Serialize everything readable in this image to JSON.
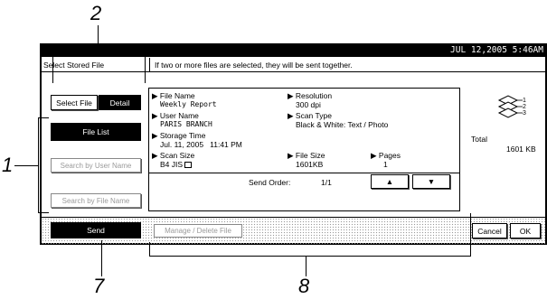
{
  "callouts": {
    "top": "2",
    "left": "1",
    "bottom_left": "7",
    "bottom_mid": "8"
  },
  "status": {
    "datetime": "JUL  12,2005  5:46AM"
  },
  "header": {
    "title": "Select Stored File",
    "notice": "If two or more files are selected, they will be sent together."
  },
  "view_buttons": {
    "select_file": "Select File",
    "detail": "Detail"
  },
  "left_buttons": {
    "file_list": "File List",
    "search_user": "Search by User Name",
    "search_file": "Search by File Name"
  },
  "details": {
    "file_name_label": "File Name",
    "file_name": "Weekly Report",
    "resolution_label": "Resolution",
    "resolution": "300 dpi",
    "user_name_label": "User Name",
    "user_name": "PARIS BRANCH",
    "scan_type_label": "Scan Type",
    "scan_type": "Black & White: Text / Photo",
    "storage_time_label": "Storage Time",
    "storage_time": "Jul. 11, 2005   11:41 PM",
    "scan_size_label": "Scan Size",
    "scan_size": "B4 JIS",
    "file_size_label": "File Size",
    "file_size": "1601KB",
    "pages_label": "Pages",
    "pages": "1"
  },
  "send_order": {
    "label": "Send Order:",
    "value": "1/1"
  },
  "total": {
    "label": "Total",
    "value": "1601 KB"
  },
  "stack_icon": {
    "labels": [
      "1",
      "2",
      "3"
    ]
  },
  "bottom": {
    "send": "Send",
    "manage": "Manage / Delete File",
    "cancel": "Cancel",
    "ok": "OK"
  },
  "icons": {
    "arrow": "triangle-right-icon",
    "up": "arrow-up-icon",
    "down": "arrow-down-icon",
    "paper": "portrait-paper-icon",
    "stack": "document-stack-icon"
  }
}
